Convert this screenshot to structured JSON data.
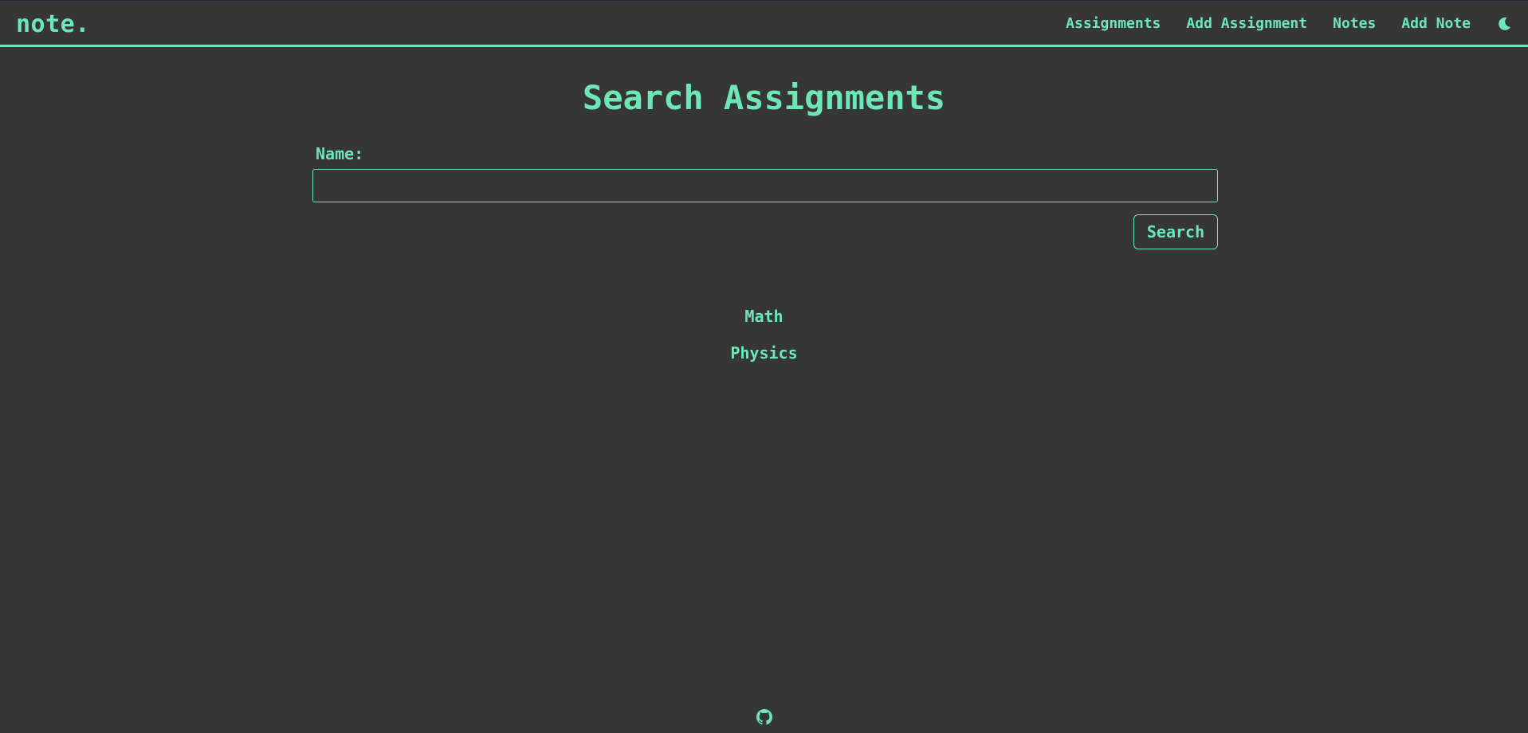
{
  "navbar": {
    "brand": "note.",
    "links": [
      {
        "label": "Assignments"
      },
      {
        "label": "Add Assignment"
      },
      {
        "label": "Notes"
      },
      {
        "label": "Add Note"
      }
    ],
    "theme_icon": "moon-icon"
  },
  "main": {
    "title": "Search Assignments",
    "form": {
      "name_label": "Name:",
      "name_value": "",
      "search_label": "Search"
    },
    "results": [
      {
        "label": "Math"
      },
      {
        "label": "Physics"
      }
    ]
  },
  "footer": {
    "icon": "github-icon"
  },
  "colors": {
    "background": "#363636",
    "accent": "#6ee7b7"
  }
}
